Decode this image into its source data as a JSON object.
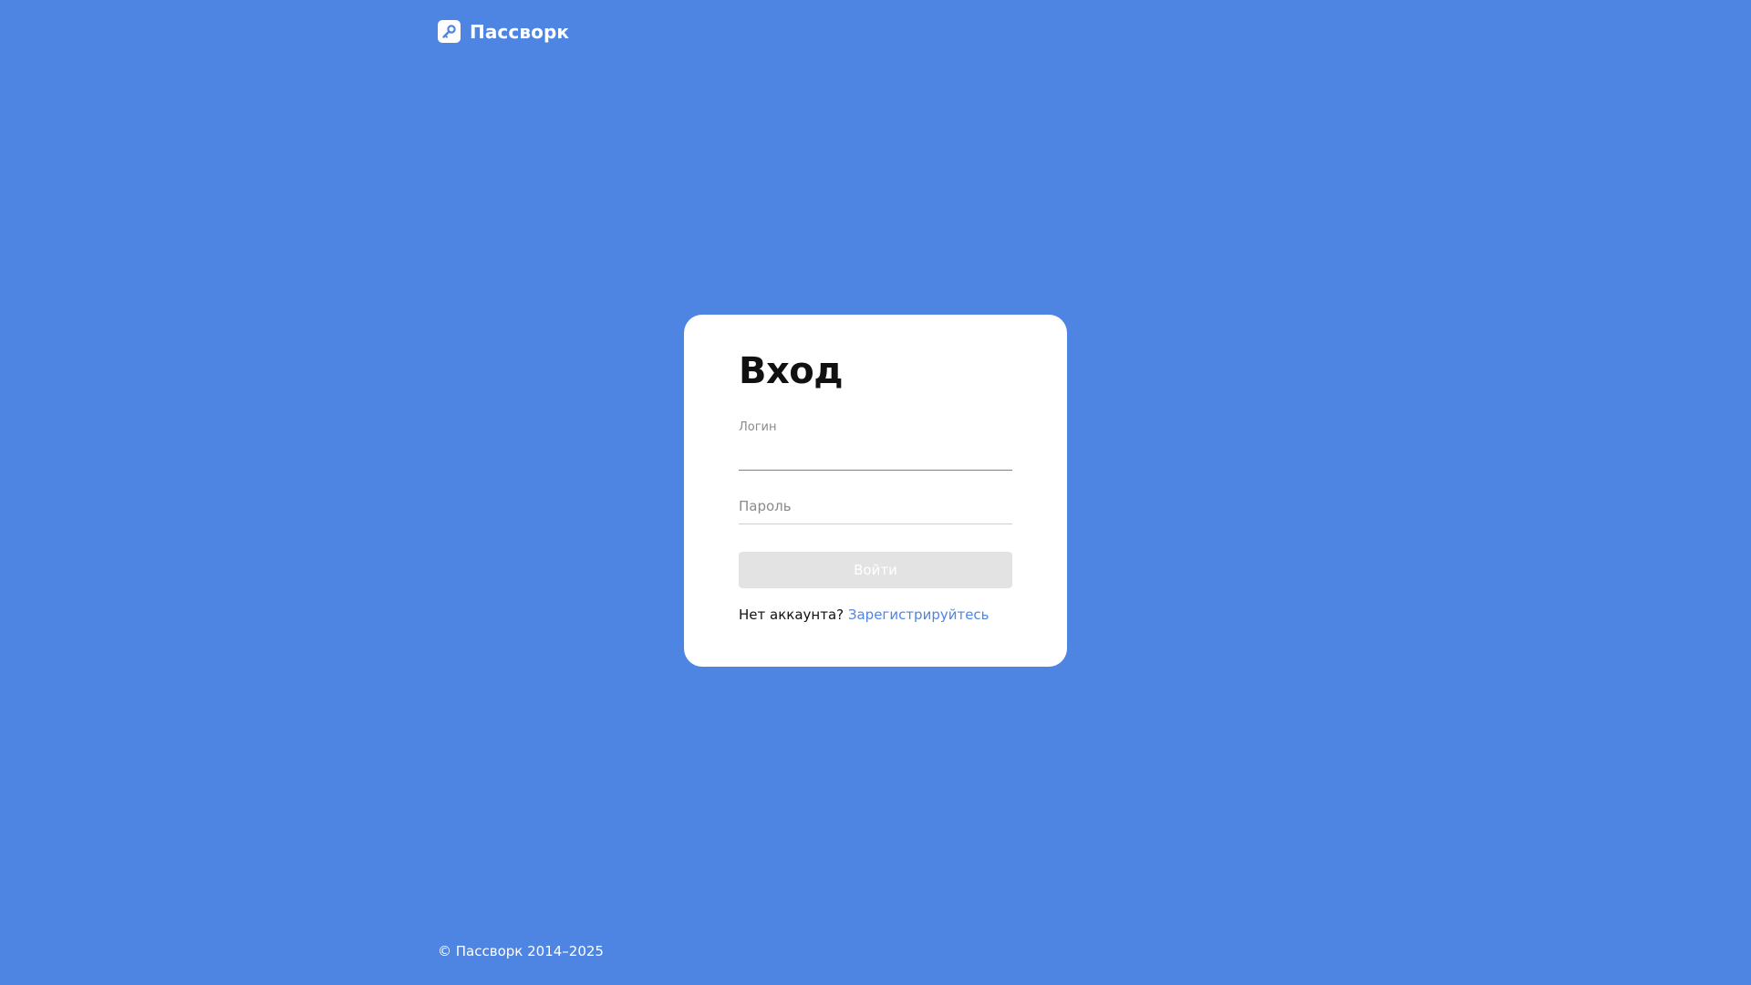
{
  "header": {
    "logo_text": "Пассворк",
    "logo_icon": "key-icon"
  },
  "login_form": {
    "title": "Вход",
    "login_label": "Логин",
    "login_value": "",
    "password_placeholder": "Пароль",
    "password_value": "",
    "submit_label": "Войти",
    "submit_disabled": true,
    "signup_prompt": "Нет аккаунта?",
    "signup_link": "Зарегистрируйтесь"
  },
  "footer": {
    "copyright": "© Пассворк 2014–2025"
  },
  "colors": {
    "background": "#4f85e2",
    "card": "#ffffff",
    "accent": "#4f85e2",
    "button_disabled": "#e3e3e3"
  }
}
